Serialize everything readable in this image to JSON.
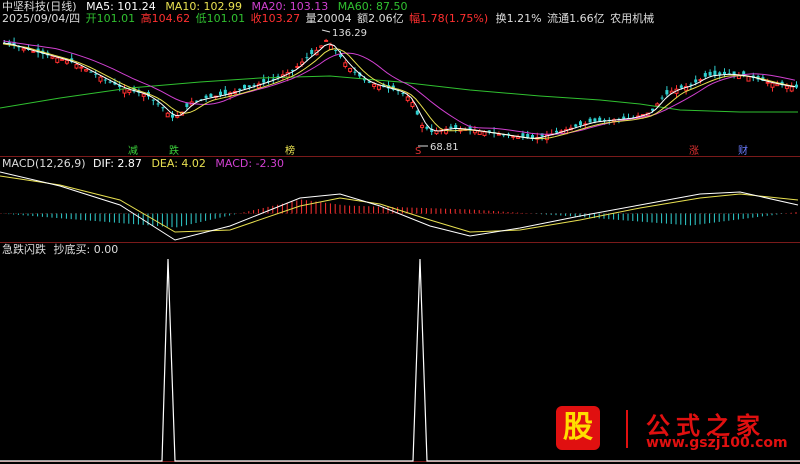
{
  "header": {
    "stock_name": "中坚科技(日线)",
    "ma5": "MA5: 101.24",
    "ma10": "MA10: 102.99",
    "ma20": "MA20: 103.13",
    "ma60": "MA60: 87.50",
    "date": "2025/09/04/四",
    "open": "开101.01",
    "high": "高104.62",
    "low": "低101.01",
    "close": "收103.27",
    "volume": "量20004",
    "amount": "额2.06亿",
    "change": "幅1.78(1.75%)",
    "turnover": "换1.21%",
    "float_cap": "流通1.66亿",
    "sector": "农用机械"
  },
  "price_annotations": {
    "high_mark": "136.29",
    "low_mark": "68.81"
  },
  "event_tags": [
    {
      "label": "减",
      "color": "#3cd23c"
    },
    {
      "label": "跌",
      "color": "#3cd23c"
    },
    {
      "label": "榜",
      "color": "#e8e050"
    },
    {
      "label": "S",
      "color": "#e03030"
    },
    {
      "label": "涨",
      "color": "#e03030"
    },
    {
      "label": "财",
      "color": "#6a7cff"
    }
  ],
  "macd_header": {
    "title": "MACD(12,26,9)",
    "dif": "DIF: 2.87",
    "dea": "DEA: 4.02",
    "macd": "MACD: -2.30"
  },
  "indicator_header": {
    "title": "急跌闪跌",
    "value": "抄底买: 0.00"
  },
  "watermark": {
    "logo_char": "股",
    "site_name": "公式之家",
    "site_url": "www.gszj100.com"
  },
  "colors": {
    "up": "#ff3030",
    "down": "#30d0d0",
    "ma5": "#ffffff",
    "ma10": "#e8e050",
    "ma20": "#d040d0",
    "ma60": "#30c030",
    "dif": "#ffffff",
    "dea": "#e8e050",
    "grid": "#7a1a1a"
  }
}
